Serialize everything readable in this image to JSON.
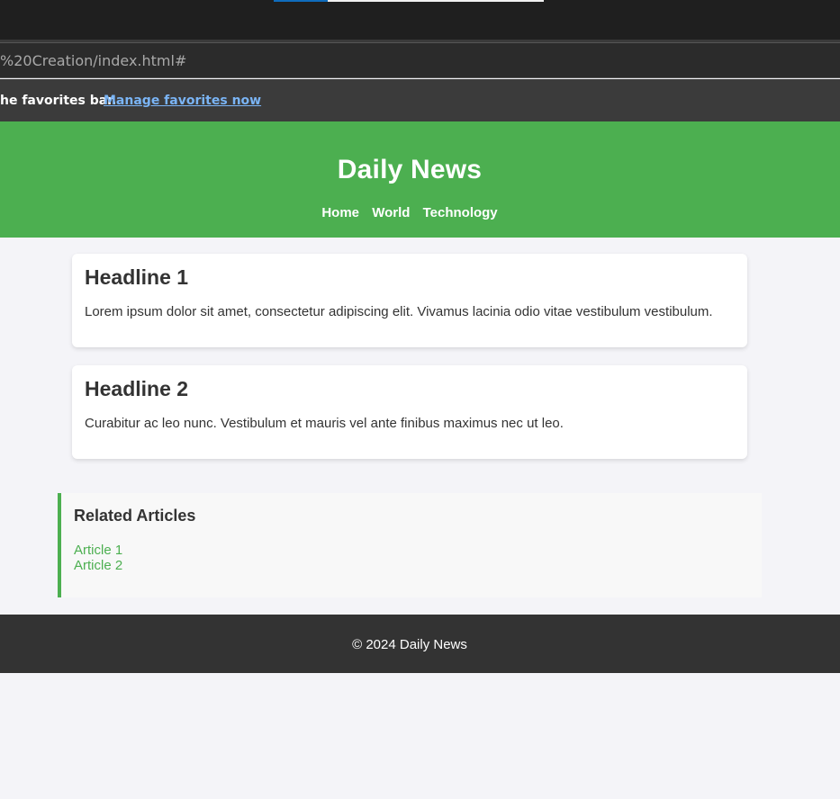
{
  "browser": {
    "address_text": "%20Creation/index.html#",
    "favorites_message": "he favorites bar.",
    "favorites_link": "Manage favorites now"
  },
  "header": {
    "title": "Daily News",
    "nav": [
      {
        "label": "Home"
      },
      {
        "label": "World"
      },
      {
        "label": "Technology"
      }
    ]
  },
  "articles": [
    {
      "headline": "Headline 1",
      "body": "Lorem ipsum dolor sit amet, consectetur adipiscing elit. Vivamus lacinia odio vitae vestibulum vestibulum."
    },
    {
      "headline": "Headline 2",
      "body": "Curabitur ac leo nunc. Vestibulum et mauris vel ante finibus maximus nec ut leo."
    }
  ],
  "related": {
    "title": "Related Articles",
    "links": [
      {
        "label": "Article 1"
      },
      {
        "label": "Article 2"
      }
    ]
  },
  "footer": {
    "text": "© 2024 Daily News"
  },
  "colors": {
    "brand_green": "#4caf50",
    "footer_dark": "#333333",
    "page_bg": "#f4f4f8"
  }
}
